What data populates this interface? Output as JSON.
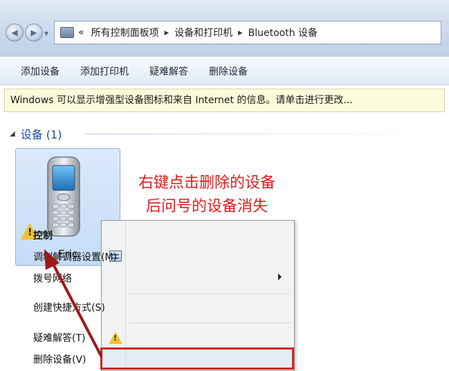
{
  "address": {
    "chevron": "«",
    "parts": [
      "所有控制面板项",
      "设备和打印机",
      "Bluetooth 设备"
    ],
    "separator": "▸"
  },
  "toolbar": {
    "add_device": "添加设备",
    "add_printer": "添加打印机",
    "troubleshoot": "疑难解答",
    "remove_device": "删除设备"
  },
  "infobar": {
    "text": "Windows 可以显示增强型设备图标和来自 Internet 的信息。请单击进行更改..."
  },
  "group": {
    "title": "设备 (1)"
  },
  "device": {
    "name": "Eric"
  },
  "annotation": {
    "line1": "右键点击删除的设备",
    "line2": "后问号的设备消失"
  },
  "context_menu": {
    "items": [
      "控制",
      "调制解调器设置(M)",
      "拨号网络",
      "创建快捷方式(S)",
      "疑难解答(T)",
      "删除设备(V)"
    ]
  },
  "colors": {
    "annotation": "#e01e1e",
    "group_header": "#1f4aa0",
    "highlight": "#c62828"
  },
  "icons": [
    "back-arrow-icon",
    "forward-arrow-icon",
    "control-panel-icon",
    "phone-icon",
    "warning-icon",
    "modem-icon",
    "submenu-arrow-icon"
  ]
}
